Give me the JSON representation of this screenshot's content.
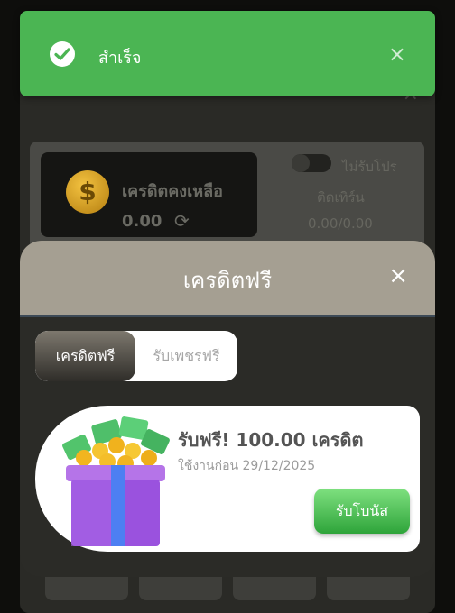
{
  "toast": {
    "message": "สำเร็จ",
    "close_symbol": "×",
    "color": "#4bb553"
  },
  "background": {
    "credit_label": "เครดิตคงเหลือ",
    "credit_value": "0.00",
    "promo_toggle_label": "ไม่รับโปร",
    "turnover_label": "ติดเทิร์น",
    "turnover_value": "0.00/0.00"
  },
  "modal": {
    "title": "เครดิตฟรี",
    "close_symbol": "×",
    "tabs": [
      {
        "label": "เครดิตฟรี",
        "active": true
      },
      {
        "label": "รับเพชรฟรี",
        "active": false
      }
    ],
    "bonus": {
      "title": "รับฟรี! 100.00 เครดิต",
      "expiry": "ใช้งานก่อน 29/12/2025",
      "claim_label": "รับโบนัส",
      "icon": "gift-box-icon"
    }
  }
}
